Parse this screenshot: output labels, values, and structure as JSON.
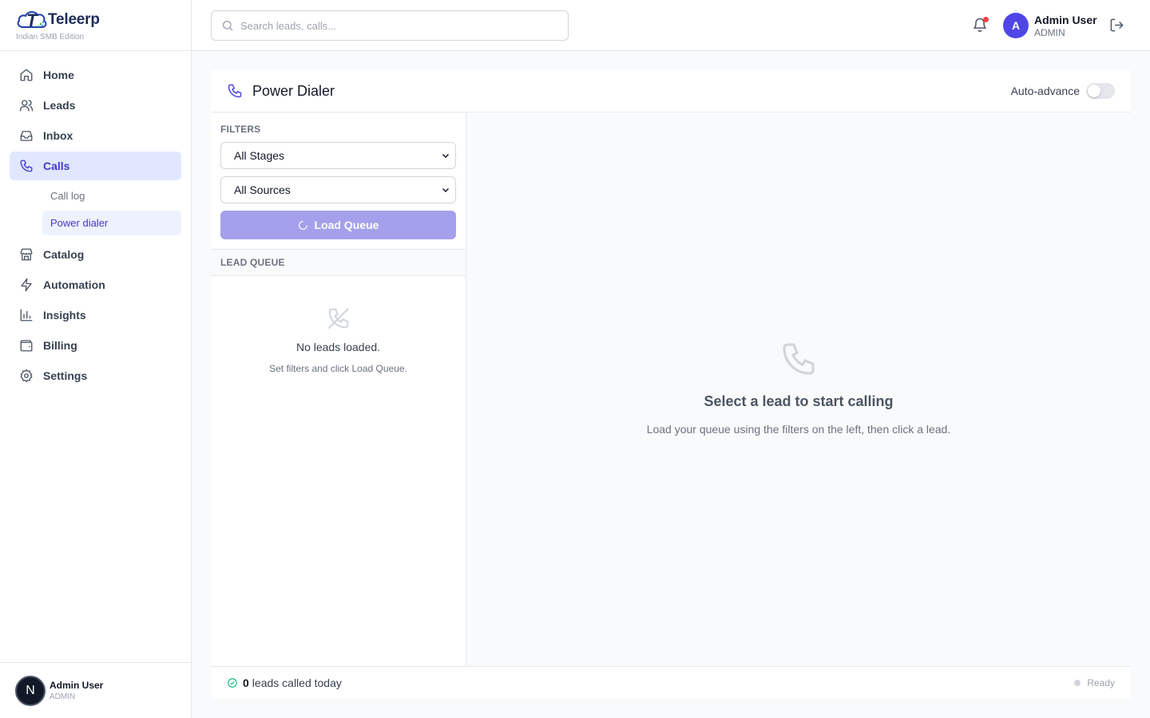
{
  "brand": {
    "name": "Teleerp",
    "subtitle": "Indian SMB Edition",
    "logo_letter": "T"
  },
  "nav": {
    "home": "Home",
    "leads": "Leads",
    "inbox": "Inbox",
    "calls": "Calls",
    "calls_sub": {
      "call_log": "Call log",
      "power_dialer": "Power dialer"
    },
    "catalog": "Catalog",
    "automation": "Automation",
    "insights": "Insights",
    "billing": "Billing",
    "settings": "Settings"
  },
  "sidebar_user": {
    "initial": "N",
    "name": "Admin User",
    "role": "ADMIN"
  },
  "header": {
    "search_placeholder": "Search leads, calls...",
    "user_initial": "A",
    "user_name": "Admin User",
    "user_role": "ADMIN"
  },
  "dialer": {
    "title": "Power Dialer",
    "auto_advance_label": "Auto-advance",
    "auto_advance_on": false,
    "filters_label": "FILTERS",
    "stage_filter": "All Stages",
    "source_filter": "All Sources",
    "load_button": "Load Queue",
    "queue_label": "LEAD QUEUE",
    "empty_title": "No leads loaded.",
    "empty_sub": "Set filters and click Load Queue.",
    "select_title": "Select a lead to start calling",
    "select_sub": "Load your queue using the filters on the left, then click a lead.",
    "called_count": "0",
    "called_text": "leads called today",
    "status": "Ready"
  },
  "colors": {
    "accent": "#4f46e5",
    "active_bg": "#e0e7ff",
    "button_disabled": "#a5a0eb",
    "success": "#10b981",
    "notification": "#ef4444"
  }
}
